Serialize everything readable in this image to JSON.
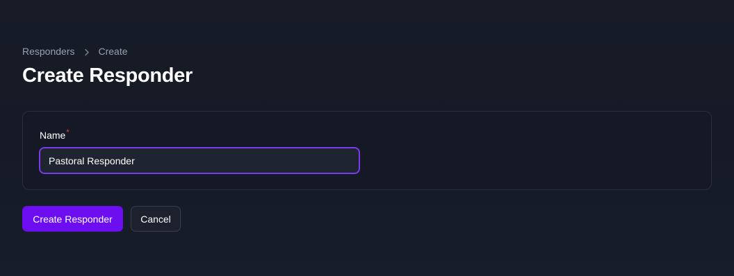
{
  "breadcrumb": {
    "items": [
      "Responders",
      "Create"
    ],
    "separator": "›"
  },
  "page": {
    "title": "Create Responder"
  },
  "form": {
    "name_label": "Name",
    "required_marker": "*",
    "name_value": "Pastoral Responder"
  },
  "actions": {
    "primary_label": "Create Responder",
    "secondary_label": "Cancel"
  },
  "colors": {
    "accent": "#6d0ef0",
    "focus_ring": "#7c3aed",
    "required": "#ef4444",
    "background": "#171c27"
  },
  "icons": {
    "breadcrumb_separator": "chevron-right-icon"
  }
}
